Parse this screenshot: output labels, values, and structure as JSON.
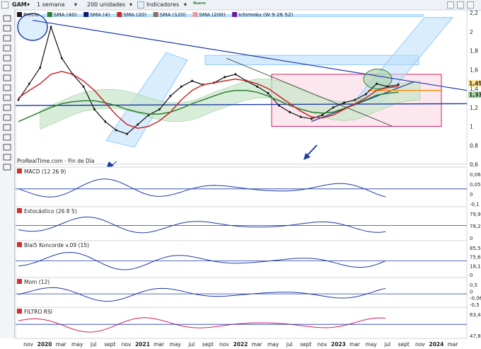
{
  "toolbar": {
    "symbol": "GAM",
    "timeframe": "1 semana",
    "units": "200 unidades",
    "indicators_button": "Indicadores",
    "new_badge": "Nuevo"
  },
  "icons": {
    "left": [
      "crosshair-icon",
      "trendline-icon",
      "ruler-icon",
      "pencil-icon",
      "rectangle-icon",
      "text-icon",
      "channel-icon",
      "fibonacci-icon",
      "magnet-icon",
      "eye-icon",
      "lock-icon",
      "trash-icon",
      "zoom-icon",
      "grid-icon",
      "settings-icon",
      "layers-icon"
    ]
  },
  "colors": {
    "price_up": "#1a3a8a",
    "price_down": "#1a1a1a",
    "sma40": "#2e7d32",
    "sma4": "#0d1b6e",
    "sma20": "#c62828",
    "sma120": "#8d6e63",
    "sma200": "#ef9a9a",
    "cloud": "#c8e6c9",
    "cloud_alt": "#d7ccc8",
    "box_pink": "#f8bbd0",
    "trend_blue": "#1e3aa8",
    "band_blue": "#bbdefb"
  },
  "legend": [
    {
      "name": "Precio",
      "color": "#1a1a1a"
    },
    {
      "name": "SMA (40)",
      "color": "#2e7d32"
    },
    {
      "name": "SMA (4)",
      "color": "#0d1b6e"
    },
    {
      "name": "SMA (20)",
      "color": "#c62828"
    },
    {
      "name": "SMA (120)",
      "color": "#8d6e63"
    },
    {
      "name": "SMA (200)",
      "color": "#ef9a9a"
    },
    {
      "name": "Ichimoku (W 9 26 52)",
      "color": "#6a1b9a"
    }
  ],
  "source_label": "ProRealTime.com - Fin de Día",
  "panels": {
    "macd": "MACD (12 26 9)",
    "stoch": "Estocástico (26 8 5)",
    "koncorde": "Blai5 Koncorde v.09 (15)",
    "mom": "Mom (12)",
    "rsi": "FILTRO RSI"
  },
  "chart_data": {
    "type": "line",
    "title": "GAM",
    "ylim": [
      0.6,
      2.2
    ],
    "y_ticks": [
      "2,2",
      "2",
      "1,8",
      "1,6",
      "1,4",
      "1,2",
      "1",
      "0,8",
      "0,6"
    ],
    "price_labels": {
      "last": "1,45",
      "sma": "1,33",
      "other": [
        "1,4",
        "1,2"
      ]
    },
    "x_ticks": [
      "nov",
      "2020",
      "mar",
      "may",
      "jul",
      "sept",
      "nov",
      "2021",
      "mar",
      "may",
      "jul",
      "sept",
      "nov",
      "2022",
      "mar",
      "may",
      "jul",
      "sept",
      "nov",
      "2023",
      "mar",
      "may",
      "jul",
      "sept",
      "nov",
      "2024",
      "mar"
    ],
    "series": [
      {
        "name": "Precio",
        "values": [
          1.28,
          1.45,
          1.62,
          2.05,
          1.72,
          1.55,
          1.42,
          1.18,
          1.05,
          0.96,
          0.92,
          1.02,
          1.12,
          1.18,
          1.32,
          1.42,
          1.48,
          1.44,
          1.46,
          1.52,
          1.55,
          1.48,
          1.42,
          1.35,
          1.22,
          1.15,
          1.1,
          1.08,
          1.12,
          1.2,
          1.25,
          1.28,
          1.34,
          1.45,
          1.42,
          1.44
        ]
      },
      {
        "name": "SMA (40)",
        "values": [
          1.05,
          1.1,
          1.15,
          1.2,
          1.24,
          1.26,
          1.27,
          1.27,
          1.25,
          1.22,
          1.18,
          1.15,
          1.13,
          1.13,
          1.15,
          1.19,
          1.24,
          1.28,
          1.32,
          1.36,
          1.38,
          1.38,
          1.36,
          1.32,
          1.27,
          1.22,
          1.18,
          1.15,
          1.14,
          1.15,
          1.19,
          1.24,
          1.28,
          1.33,
          1.35,
          1.36
        ]
      },
      {
        "name": "SMA (20)",
        "values": [
          1.3,
          1.38,
          1.45,
          1.55,
          1.58,
          1.55,
          1.48,
          1.38,
          1.25,
          1.12,
          1.02,
          0.98,
          1.0,
          1.06,
          1.15,
          1.28,
          1.38,
          1.44,
          1.46,
          1.48,
          1.5,
          1.48,
          1.45,
          1.4,
          1.32,
          1.24,
          1.16,
          1.1,
          1.09,
          1.12,
          1.18,
          1.24,
          1.3,
          1.38,
          1.41,
          1.42
        ]
      }
    ],
    "macd_ticks": [
      "0,062",
      "0,051",
      "0",
      "-0,1"
    ],
    "stoch_ticks": [
      "79,95",
      "78,21",
      "0"
    ],
    "koncorde_ticks": [
      "85,54",
      "75,61",
      "18,15",
      "0"
    ],
    "mom_ticks": [
      "0,5",
      "0",
      "-0,061",
      "-0,5"
    ],
    "rsi_ticks": [
      "63,40",
      "47,83"
    ]
  }
}
